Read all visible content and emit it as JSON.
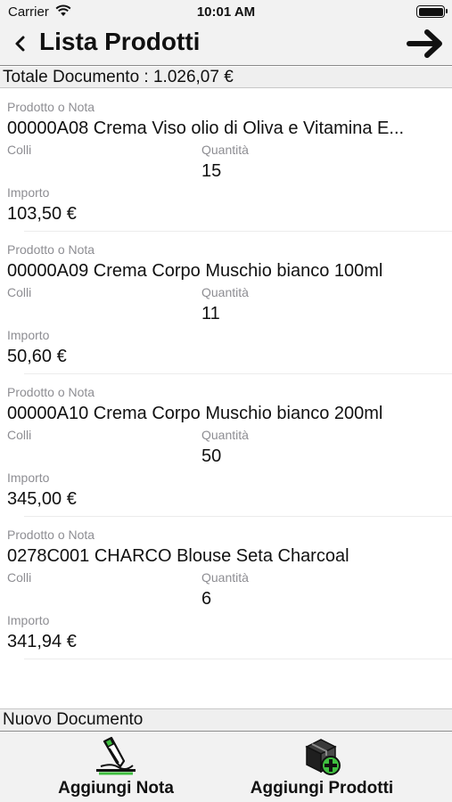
{
  "status": {
    "carrier": "Carrier",
    "time": "10:01 AM",
    "wifi_icon": "wifi-icon",
    "battery_icon": "battery-icon"
  },
  "nav": {
    "back_icon": "chevron-left-icon",
    "title": "Lista Prodotti",
    "forward_icon": "arrow-right-icon"
  },
  "total": {
    "text": "Totale Documento : 1.026,07 €"
  },
  "labels": {
    "product": "Prodotto o Nota",
    "colli": "Colli",
    "quantity": "Quantità",
    "amount": "Importo"
  },
  "items": [
    {
      "product": "00000A08  Crema Viso olio di Oliva e Vitamina E...",
      "colli": "",
      "quantity": "15",
      "amount": "103,50 €"
    },
    {
      "product": "00000A09  Crema Corpo Muschio bianco 100ml",
      "colli": "",
      "quantity": "11",
      "amount": "50,60 €"
    },
    {
      "product": "00000A10  Crema Corpo Muschio bianco 200ml",
      "colli": "",
      "quantity": "50",
      "amount": "345,00 €"
    },
    {
      "product": "0278C001  CHARCO  Blouse Seta Charcoal",
      "colli": "",
      "quantity": "6",
      "amount": "341,94 €"
    }
  ],
  "section": {
    "title": "Nuovo Documento"
  },
  "toolbar": {
    "add_note_label": "Aggiungi Nota",
    "add_note_icon": "pencil-note-icon",
    "add_products_label": "Aggiungi Prodotti",
    "add_products_icon": "box-add-icon"
  },
  "colors": {
    "bar_background": "#f2f2f2",
    "label_gray": "#8e8e93",
    "accent_green": "#3fbf3f"
  }
}
